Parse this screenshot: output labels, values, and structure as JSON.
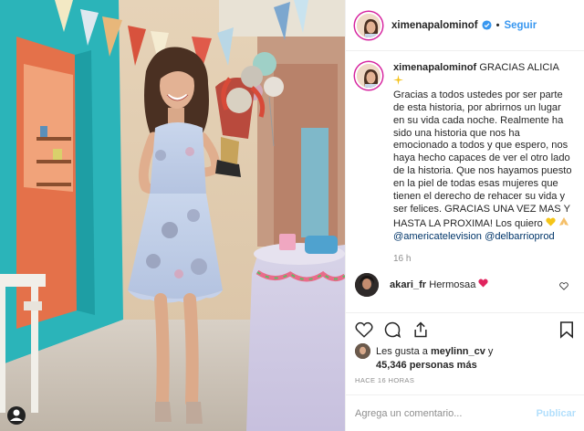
{
  "post": {
    "username": "ximenapalominof",
    "follow_label": "Seguir",
    "separator": "•",
    "caption": {
      "greeting": "GRACIAS ALICIA",
      "emoji": "sparkles",
      "text": "Gracias a todos ustedes por ser parte de esta historia, por abrirnos un lugar en su vida cada noche. Realmente ha sido una historia que nos ha emocionado a todos y que espero, nos haya hecho capaces de ver el otro lado de la historia. Que nos hayamos puesto en la piel de todas esas mujeres que tienen el derecho de rehacer su vida y ser felices. GRACIAS UNA VEZ MAS Y HASTA LA PROXIMA! Los quiero",
      "closing_emojis": [
        "yellow-heart",
        "praying-hands"
      ],
      "mentions": [
        "@americatelevision",
        "@delbarrioprod"
      ],
      "time": "16 h"
    },
    "comments": [
      {
        "username": "akari_fr",
        "text": "Hermosaa",
        "emoji": "red-heart"
      }
    ],
    "likes": {
      "prefix": "Les gusta a",
      "liker": "meylinn_cv",
      "joiner": "y",
      "count": "45,346 personas más"
    },
    "timestamp": "HACE 16 HORAS",
    "add_comment": {
      "placeholder": "Agrega un comentario...",
      "publish_label": "Publicar"
    }
  },
  "icons": [
    "heart-icon",
    "comment-icon",
    "share-icon",
    "bookmark-icon",
    "verified-badge-icon",
    "more-options-icon"
  ],
  "colors": {
    "link": "#3897f0",
    "mention": "#003569",
    "muted": "#8e8e8e",
    "verified": "#3897f0",
    "publish_disabled": "#b2dffc"
  }
}
